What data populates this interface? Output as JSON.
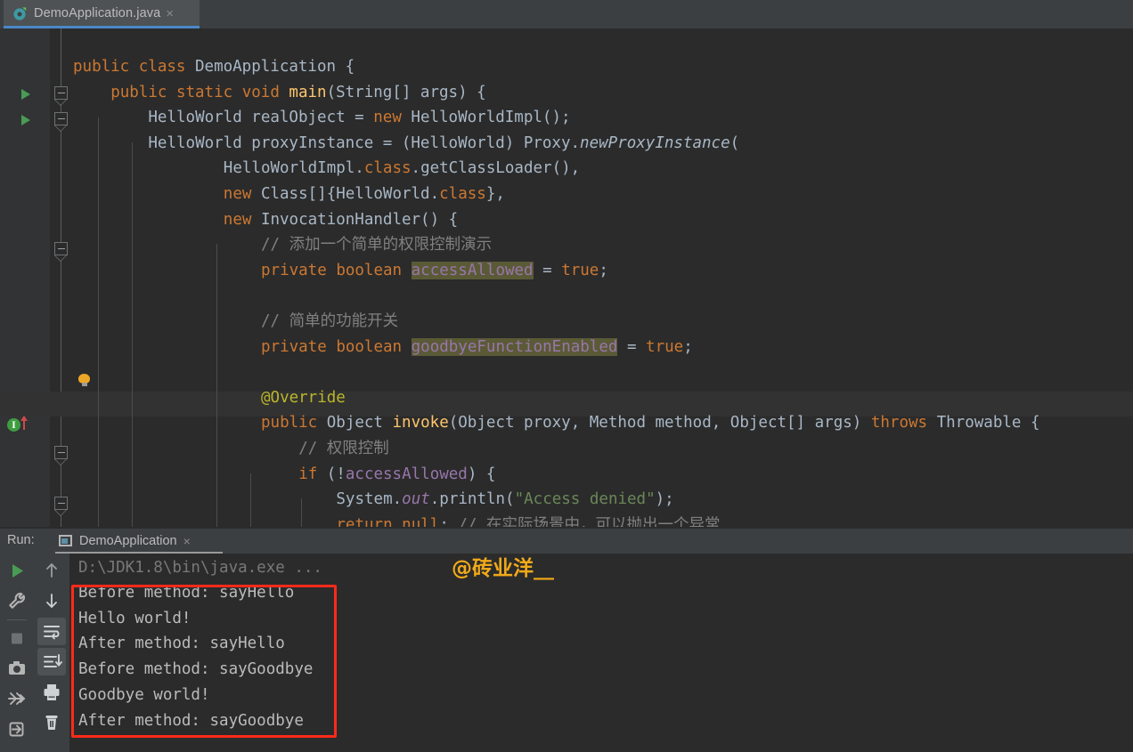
{
  "window": {
    "accent_blue": "#4a88c7",
    "editor_bg": "#2b2b2b",
    "panel_bg": "#3c3f41",
    "highlight_bg": "#5a5a36",
    "red_box": "#fe2b19",
    "watermark_color": "#f0a919"
  },
  "tabs": [
    {
      "label": "DemoApplication.java",
      "icon": "java-class-icon",
      "close": "×",
      "active": true
    }
  ],
  "editor": {
    "language": "java",
    "code_lines": [
      {
        "indent": 0,
        "tokens": [
          {
            "t": "public",
            "c": "kw"
          },
          {
            "t": " ",
            "c": "pl"
          },
          {
            "t": "class",
            "c": "kw"
          },
          {
            "t": " ",
            "c": "pl"
          },
          {
            "t": "DemoApplication",
            "c": "cls"
          },
          {
            "t": " {",
            "c": "pl"
          }
        ]
      },
      {
        "indent": 1,
        "tokens": [
          {
            "t": "public",
            "c": "kw"
          },
          {
            "t": " ",
            "c": "pl"
          },
          {
            "t": "static",
            "c": "kw"
          },
          {
            "t": " ",
            "c": "pl"
          },
          {
            "t": "void",
            "c": "kw"
          },
          {
            "t": " ",
            "c": "pl"
          },
          {
            "t": "main",
            "c": "fn"
          },
          {
            "t": "(String[] args) {",
            "c": "pl"
          }
        ]
      },
      {
        "indent": 2,
        "tokens": [
          {
            "t": "HelloWorld realObject = ",
            "c": "pl"
          },
          {
            "t": "new",
            "c": "kw"
          },
          {
            "t": " HelloWorldImpl();",
            "c": "pl"
          }
        ]
      },
      {
        "indent": 2,
        "tokens": [
          {
            "t": "HelloWorld proxyInstance = (HelloWorld) Proxy.",
            "c": "pl"
          },
          {
            "t": "newProxyInstance",
            "c": "fn-i"
          },
          {
            "t": "(",
            "c": "pl"
          }
        ]
      },
      {
        "indent": 4,
        "tokens": [
          {
            "t": "HelloWorldImpl.",
            "c": "pl"
          },
          {
            "t": "class",
            "c": "kw"
          },
          {
            "t": ".getClassLoader(),",
            "c": "pl"
          }
        ]
      },
      {
        "indent": 4,
        "tokens": [
          {
            "t": "new",
            "c": "kw"
          },
          {
            "t": " Class[]{HelloWorld.",
            "c": "pl"
          },
          {
            "t": "class",
            "c": "kw"
          },
          {
            "t": "},",
            "c": "pl"
          }
        ]
      },
      {
        "indent": 4,
        "tokens": [
          {
            "t": "new",
            "c": "kw"
          },
          {
            "t": " InvocationHandler() {",
            "c": "pl"
          }
        ]
      },
      {
        "indent": 5,
        "tokens": [
          {
            "t": "// 添加一个简单的权限控制演示",
            "c": "cm"
          }
        ]
      },
      {
        "indent": 5,
        "tokens": [
          {
            "t": "private",
            "c": "kw"
          },
          {
            "t": " ",
            "c": "pl"
          },
          {
            "t": "boolean",
            "c": "kw"
          },
          {
            "t": " ",
            "c": "pl"
          },
          {
            "t": "accessAllowed",
            "c": "fld-hl"
          },
          {
            "t": " = ",
            "c": "pl"
          },
          {
            "t": "true",
            "c": "kw"
          },
          {
            "t": ";",
            "c": "pl"
          }
        ]
      },
      {
        "indent": 5,
        "tokens": []
      },
      {
        "indent": 5,
        "tokens": [
          {
            "t": "// 简单的功能开关",
            "c": "cm"
          }
        ]
      },
      {
        "indent": 5,
        "tokens": [
          {
            "t": "private",
            "c": "kw"
          },
          {
            "t": " ",
            "c": "pl"
          },
          {
            "t": "boolean",
            "c": "kw"
          },
          {
            "t": " ",
            "c": "pl"
          },
          {
            "t": "goodbyeFunctionEnabled",
            "c": "fld-hl"
          },
          {
            "t": " = ",
            "c": "pl"
          },
          {
            "t": "true",
            "c": "kw"
          },
          {
            "t": ";",
            "c": "pl"
          }
        ]
      },
      {
        "indent": 5,
        "tokens": []
      },
      {
        "indent": 5,
        "tokens": [
          {
            "t": "@Override",
            "c": "an"
          }
        ]
      },
      {
        "indent": 5,
        "tokens": [
          {
            "t": "public",
            "c": "kw"
          },
          {
            "t": " Object ",
            "c": "pl"
          },
          {
            "t": "invoke",
            "c": "fn"
          },
          {
            "t": "(Object proxy, Method method, Object[] args) ",
            "c": "pl"
          },
          {
            "t": "throws",
            "c": "kw"
          },
          {
            "t": " Throwable {",
            "c": "pl"
          }
        ]
      },
      {
        "indent": 6,
        "tokens": [
          {
            "t": "// 权限控制",
            "c": "cm"
          }
        ]
      },
      {
        "indent": 6,
        "tokens": [
          {
            "t": "if",
            "c": "kw"
          },
          {
            "t": " (!",
            "c": "pl"
          },
          {
            "t": "accessAllowed",
            "c": "fld"
          },
          {
            "t": ") {",
            "c": "pl"
          }
        ]
      },
      {
        "indent": 7,
        "tokens": [
          {
            "t": "System.",
            "c": "pl"
          },
          {
            "t": "out",
            "c": "sf"
          },
          {
            "t": ".println(",
            "c": "pl"
          },
          {
            "t": "\"Access denied\"",
            "c": "st"
          },
          {
            "t": ");",
            "c": "pl"
          }
        ]
      },
      {
        "indent": 7,
        "tokens": [
          {
            "t": "return",
            "c": "kw"
          },
          {
            "t": " ",
            "c": "pl"
          },
          {
            "t": "null",
            "c": "kw"
          },
          {
            "t": "; ",
            "c": "pl"
          },
          {
            "t": "// 在实际场景中，可以抛出一个异常",
            "c": "cm"
          }
        ]
      }
    ],
    "gutter": {
      "run_markers": "green-play-triangle",
      "intention_bulb": "lightbulb-icon",
      "implements_marker": "I",
      "override_arrow": "red-up-arrow"
    }
  },
  "run_panel": {
    "label": "Run:",
    "tab": {
      "label": "DemoApplication",
      "icon": "run-config-icon",
      "close": "×"
    },
    "left_tools": [
      {
        "name": "rerun-button",
        "icon": "play-icon"
      },
      {
        "name": "edit-configuration-button",
        "icon": "wrench-icon"
      },
      {
        "name": "stop-button",
        "icon": "stop-square-icon"
      },
      {
        "name": "screenshot-button",
        "icon": "camera-icon"
      },
      {
        "name": "dump-threads-button",
        "icon": "thread-dump-icon"
      },
      {
        "name": "resume-button",
        "icon": "exit-arrow-icon"
      }
    ],
    "right_tools": [
      {
        "name": "scroll-up-button",
        "icon": "arrow-up-icon"
      },
      {
        "name": "scroll-down-button",
        "icon": "arrow-down-icon"
      },
      {
        "name": "soft-wrap-button",
        "icon": "soft-wrap-icon",
        "active": true
      },
      {
        "name": "scroll-to-end-button",
        "icon": "scroll-to-end-icon",
        "active": true
      },
      {
        "name": "print-button",
        "icon": "printer-icon"
      },
      {
        "name": "clear-all-button",
        "icon": "trash-icon"
      }
    ],
    "console": {
      "command_line": "D:\\JDK1.8\\bin\\java.exe ...",
      "output_lines": [
        "Before method: sayHello",
        "Hello world!",
        "After method: sayHello",
        "Before method: sayGoodbye",
        "Goodbye world!",
        "After method: sayGoodbye"
      ]
    }
  },
  "watermark": {
    "text": "@砖业洋__"
  }
}
